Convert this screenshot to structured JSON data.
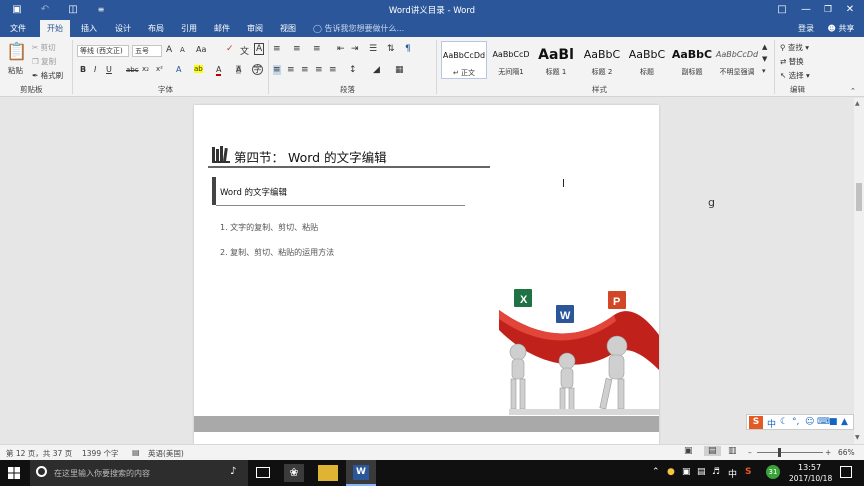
{
  "window": {
    "title": "Word讲义目录 - Word",
    "signin": "登录",
    "share": "共享"
  },
  "tabs": [
    "文件",
    "开始",
    "插入",
    "设计",
    "布局",
    "引用",
    "邮件",
    "审阅",
    "视图"
  ],
  "tell_me": "告诉我您想要做什么...",
  "ribbon": {
    "clipboard": {
      "paste": "粘贴",
      "cut": "剪切",
      "copy": "复制",
      "format_painter": "格式刷",
      "label": "剪贴板"
    },
    "font": {
      "name": "等线 (西文正)",
      "size": "五号",
      "label": "字体",
      "bold": "B",
      "italic": "I",
      "underline": "U",
      "strike": "abc",
      "sub": "x₂",
      "sup": "x²",
      "grow": "A",
      "shrink": "A",
      "case": "Aa",
      "effects": "A",
      "highlight": "ab",
      "color": "A",
      "char_shade": "A",
      "enclosed": "字"
    },
    "paragraph": {
      "label": "段落"
    },
    "styles": {
      "label": "样式",
      "items": [
        {
          "sample": "AaBbCcDd",
          "name": "正文"
        },
        {
          "sample": "AaBbCcD",
          "name": "无间隔1"
        },
        {
          "sample": "AaBl",
          "name": "标题 1"
        },
        {
          "sample": "AaBbC",
          "name": "标题 2"
        },
        {
          "sample": "AaBbC",
          "name": "标题"
        },
        {
          "sample": "AaBbC",
          "name": "副标题"
        },
        {
          "sample": "AaBbCcDd",
          "name": "不明显强调"
        }
      ]
    },
    "editing": {
      "find": "查找",
      "replace": "替换",
      "select": "选择",
      "label": "编辑"
    }
  },
  "document": {
    "heading": "第四节：  Word 的文字编辑",
    "subheading": "Word 的文字编辑",
    "items": [
      "1. 文字的复制、剪切、粘贴",
      "2. 复制、剪切、粘贴的运用方法"
    ],
    "app_icons": [
      "X",
      "W",
      "P"
    ]
  },
  "status": {
    "page": "第 12 页，共 37 页",
    "words": "1399 个字",
    "language": "英语(美国)",
    "zoom": "66%",
    "zoom_level": 0.66
  },
  "ime": {
    "labels": [
      "中"
    ]
  },
  "taskbar": {
    "search_placeholder": "在这里输入你要搜索的内容",
    "tray_lang": "中",
    "tray_badge": "31",
    "time": "13:57",
    "date": "2017/10/18"
  },
  "colors": {
    "accent": "#2b579a",
    "ribbon_bg": "#f3f3f3",
    "page_bg": "#ffffff",
    "heading_bar": "#555555"
  }
}
